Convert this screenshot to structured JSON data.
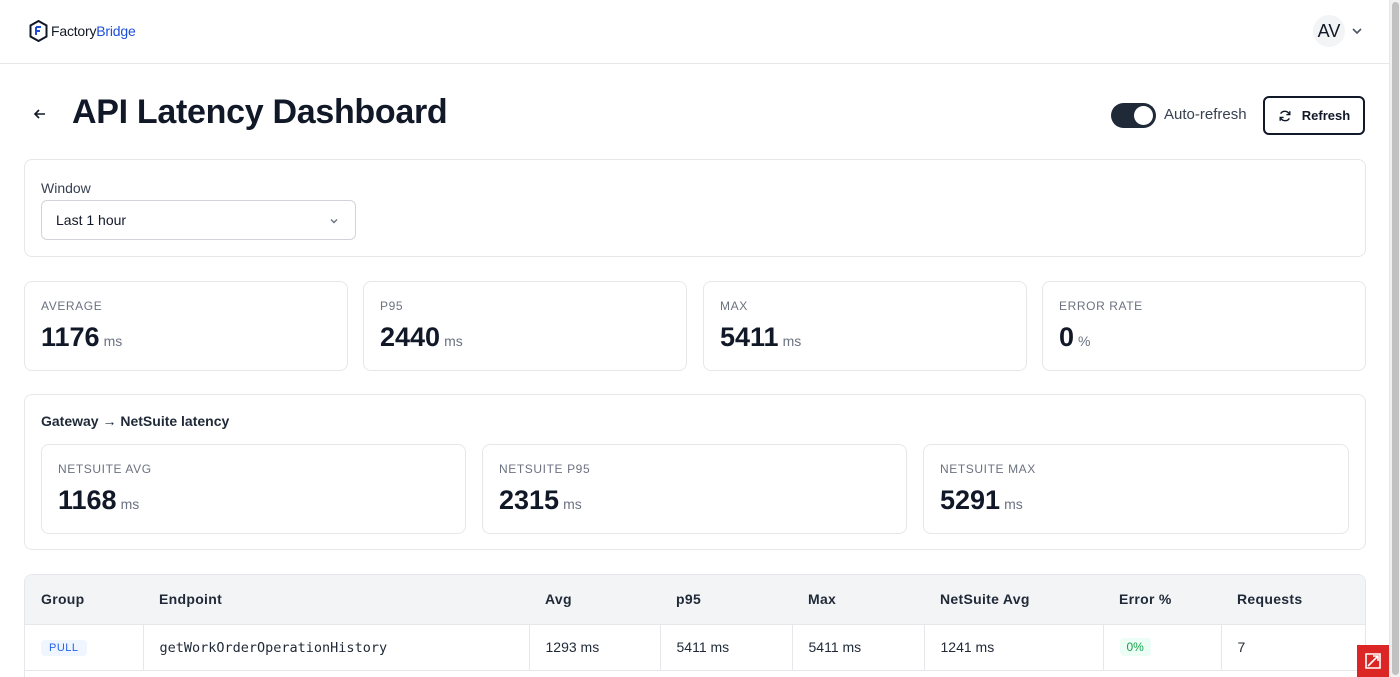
{
  "brand": {
    "name_main": "Factory",
    "name_accent": "Bridge",
    "accent_color": "#1d4ed8"
  },
  "user": {
    "initials": "AV"
  },
  "header": {
    "title": "API Latency Dashboard",
    "auto_refresh_label": "Auto-refresh",
    "auto_refresh_on": true,
    "refresh_label": "Refresh"
  },
  "window": {
    "label": "Window",
    "selected": "Last 1 hour"
  },
  "stats": [
    {
      "label": "AVERAGE",
      "value": "1176",
      "unit": "ms"
    },
    {
      "label": "P95",
      "value": "2440",
      "unit": "ms"
    },
    {
      "label": "MAX",
      "value": "5411",
      "unit": "ms"
    },
    {
      "label": "ERROR RATE",
      "value": "0",
      "unit": "%"
    }
  ],
  "gateway": {
    "title": "Gateway → NetSuite latency",
    "stats": [
      {
        "label": "NETSUITE AVG",
        "value": "1168",
        "unit": "ms"
      },
      {
        "label": "NETSUITE P95",
        "value": "2315",
        "unit": "ms"
      },
      {
        "label": "NETSUITE MAX",
        "value": "5291",
        "unit": "ms"
      }
    ]
  },
  "table": {
    "columns": [
      "Group",
      "Endpoint",
      "Avg",
      "p95",
      "Max",
      "NetSuite Avg",
      "Error %",
      "Requests"
    ],
    "rows": [
      {
        "group": "PULL",
        "endpoint": "getWorkOrderOperationHistory",
        "avg": "1293 ms",
        "p95": "5411 ms",
        "max": "5411 ms",
        "netsuite_avg": "1241 ms",
        "error": "0%",
        "requests": "7"
      }
    ]
  }
}
